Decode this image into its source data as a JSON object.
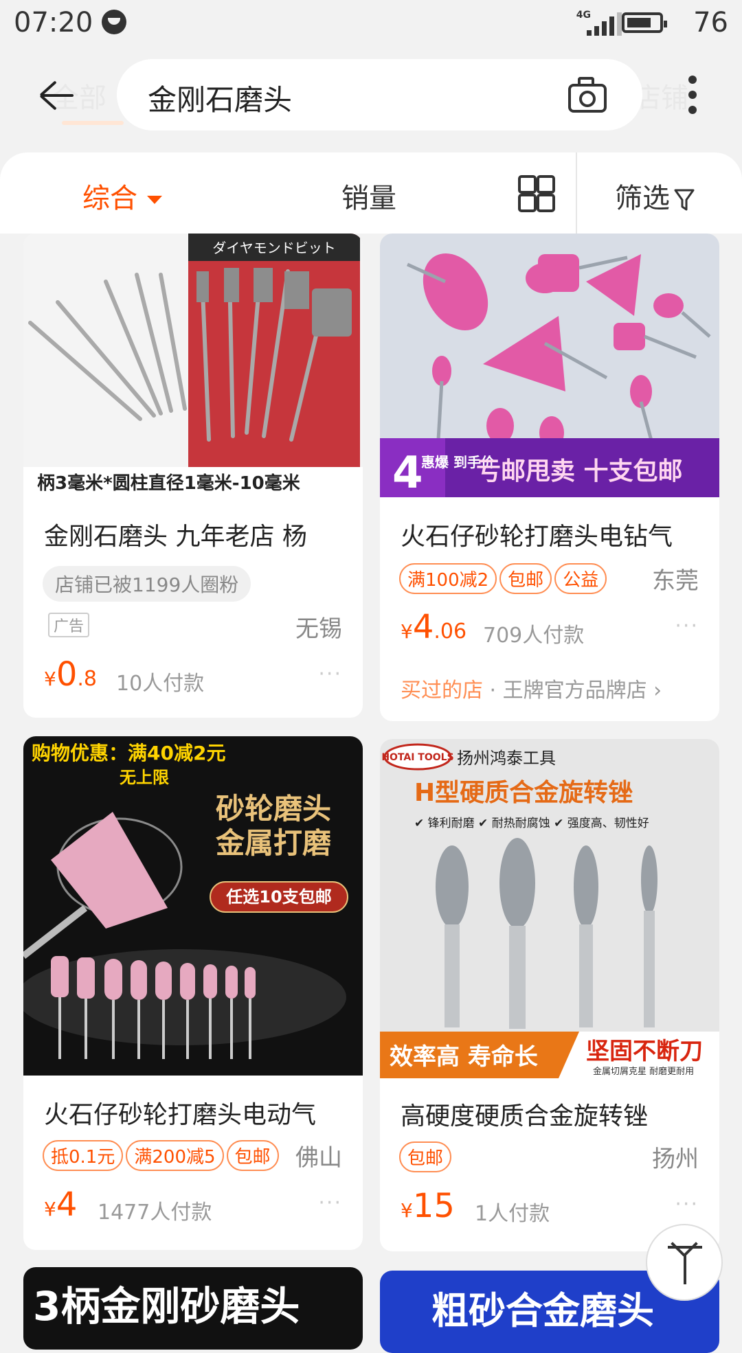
{
  "status": {
    "time": "07:20",
    "network": "4G",
    "battery": "76"
  },
  "header": {
    "ghost_tab_left": "全部",
    "ghost_tab_right": "店铺",
    "search_query": "金刚石磨头"
  },
  "sortbar": {
    "comprehensive": "综合",
    "sales": "销量",
    "filter": "筛选"
  },
  "products": [
    {
      "image_caption": "柄3毫米*圆柱直径1毫米-10毫米",
      "title": "金刚石磨头 九年老店 杨",
      "fans": "店铺已被1199人圈粉",
      "ad_label": "广告",
      "location": "无锡",
      "price_int": "0",
      "price_dec": ".8",
      "sold": "10人付款"
    },
    {
      "banner_left": "4",
      "banner_tag": "惠爆 到手价",
      "banner_right": "亏邮甩卖 十支包邮",
      "title": "火石仔砂轮打磨头电钻气",
      "tags": [
        "满100减2",
        "包邮",
        "公益"
      ],
      "location": "东莞",
      "price_int": "4",
      "price_dec": ".06",
      "sold": "709人付款",
      "shop_highlight": "买过的店",
      "shop_rest": " · 王牌官方品牌店 ›"
    },
    {
      "promo_line1": "购物优惠：满40减2元",
      "promo_line2": "无上限",
      "promo_big1": "砂轮磨头",
      "promo_big2": "金属打磨",
      "promo_badge": "任选10支包邮",
      "title": "火石仔砂轮打磨头电动气",
      "tags": [
        "抵0.1元",
        "满200减5",
        "包邮"
      ],
      "location": "佛山",
      "price_int": "4",
      "price_dec": "",
      "sold": "1477人付款"
    },
    {
      "brand": "HOTAI TOOLS",
      "company": "扬州鸿泰工具",
      "headline": "H型硬质合金旋转锉",
      "features": "✔ 锋利耐磨  ✔ 耐热耐腐蚀  ✔ 强度高、韧性好",
      "footer_left": "效率高 寿命长",
      "footer_right": "坚固不断刀",
      "footer_small": "金属切屑克星  耐磨更耐用",
      "title": "高硬度硬质合金旋转锉",
      "tags": [
        "包邮"
      ],
      "location": "扬州",
      "price_int": "15",
      "price_dec": "",
      "sold": "1人付款"
    }
  ],
  "peek": {
    "left": "3柄金刚砂磨头",
    "right": "粗砂合金磨头"
  },
  "ui": {
    "currency": "¥",
    "ellipsis": "···"
  }
}
